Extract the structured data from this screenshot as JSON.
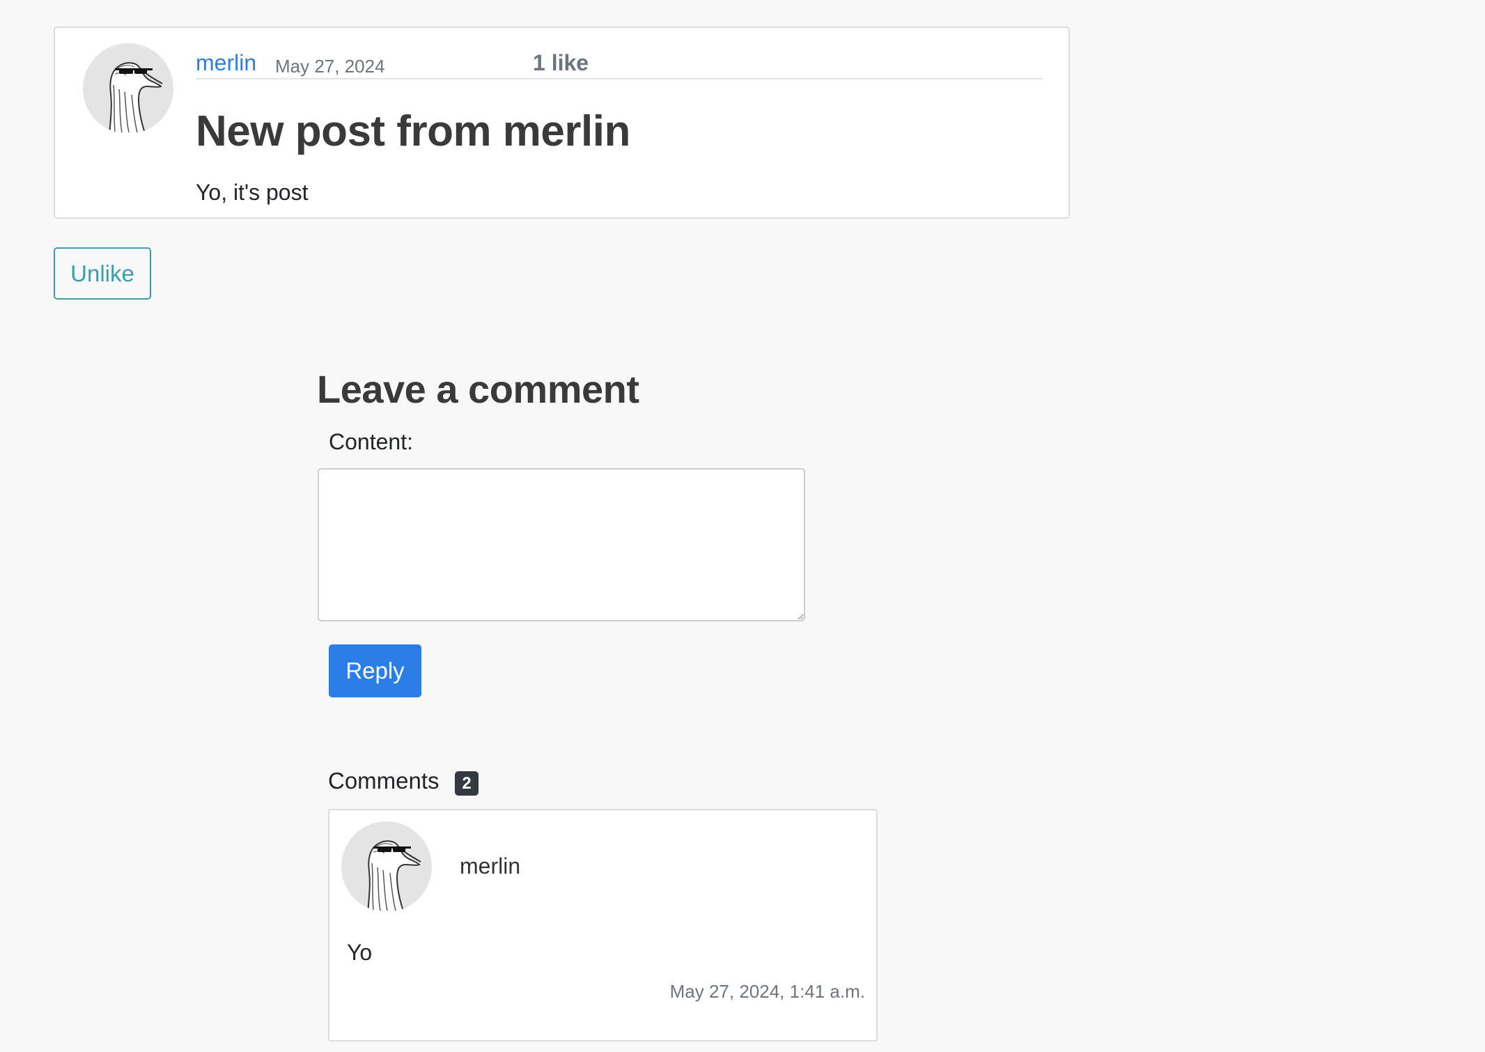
{
  "post": {
    "author": "merlin",
    "date": "May 27, 2024",
    "likes": "1 like",
    "title": "New post from merlin",
    "body": "Yo, it's post",
    "avatar_icon": "goose-with-sunglasses-icon"
  },
  "actions": {
    "unlike_label": "Unlike"
  },
  "comment_form": {
    "heading": "Leave a comment",
    "content_label": "Content:",
    "content_value": "",
    "reply_label": "Reply"
  },
  "comments": {
    "heading": "Comments",
    "count": "2",
    "items": [
      {
        "author": "merlin",
        "text": "Yo",
        "date": "May 27, 2024, 1:41 a.m.",
        "avatar_icon": "goose-with-sunglasses-icon"
      }
    ]
  },
  "colors": {
    "link": "#2a7ee6",
    "outline_button": "#3a9fab",
    "primary_button": "#2a7ee6",
    "badge": "#343a40",
    "muted_text": "#6c757d",
    "page_background": "#f8f8f8"
  }
}
